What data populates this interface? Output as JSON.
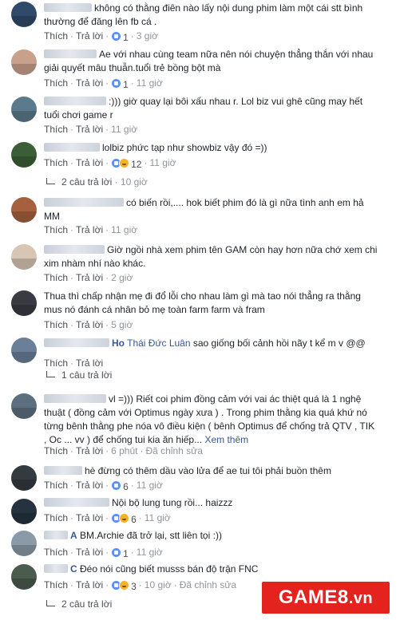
{
  "ui": {
    "like": "Thích",
    "reply": "Trả lời",
    "edited": "Đã chỉnh sửa",
    "see_more": "Xem thêm"
  },
  "comments": [
    {
      "name": "",
      "name_visible": "",
      "text": "không có thằng điên nào lấy nội dung phim làm một cái stt bình thường để đăng lên fb cá .",
      "reactions": [
        "like"
      ],
      "count": "1",
      "time": "3 giờ",
      "edited": false
    },
    {
      "name": "",
      "name_visible": "",
      "text": "Ae với nhau cùng team nữa nên nói chuyện thẳng thắn với nhau giải quyết mâu thuẫn.tuổi trẻ bồng bột mà",
      "reactions": [
        "like"
      ],
      "count": "1",
      "time": "11 giờ",
      "edited": false
    },
    {
      "name": "",
      "name_visible": "",
      "text": ":))) giờ quay lại bôi xấu nhau r. Lol biz vui ghê cũng may hết tuổi chơi game r",
      "reactions": [],
      "count": "",
      "time": "11 giờ",
      "edited": false
    },
    {
      "name": "",
      "name_visible": "",
      "text": "lolbiz phức tạp như showbiz vậy đó =))",
      "reactions": [
        "like",
        "haha"
      ],
      "count": "12",
      "time": "11 giờ",
      "edited": false,
      "replies": "2 câu trả lời",
      "replies_time": "10 giờ"
    },
    {
      "name": "",
      "name_visible": "",
      "text": "có biến rồi,.... hok biết phim đó là gì nữa tình anh em hả MM",
      "reactions": [],
      "count": "",
      "time": "11 giờ",
      "edited": false
    },
    {
      "name": "",
      "name_visible": "",
      "text": "Giờ ngồi nhà xem phim tên GAM còn hay hơn nữa chớ xem chi xim nhàm nhí nào khác.",
      "reactions": [],
      "count": "",
      "time": "2 giờ",
      "edited": false
    },
    {
      "name": "",
      "name_visible": "",
      "text": "Thua thì chấp nhận mẹ đi đổ lỗi cho nhau làm gì mà tao nói thẳng ra thằng mus nó đánh cá nhân bỏ mẹ toàn farm farm và fram",
      "reactions": [],
      "count": "",
      "time": "5 giờ",
      "edited": false
    },
    {
      "name": "",
      "name_visible": "Ho",
      "tag": "Thái Đức Luân",
      "text": "sao giống bối cảnh hồi nãy t kể m v @@",
      "reactions": [],
      "count": "",
      "time": "",
      "edited": false,
      "replies": "1 câu trả lời",
      "replies_time": ""
    },
    {
      "name": "",
      "name_visible": "",
      "text": "vl =)))  Riết coi phim đồng cảm với vai ác thiệt quá là 1 nghệ thuật ( đồng cảm với Optimus ngày xưa ) . Trong phim thằng kia quá khứ nó từng bênh thằng phe nóa vô điều kiện ( bênh Optimus để chống trả QTV , TIK , Oc ... vv ) để chống tui kia ăn hiếp...",
      "reactions": [],
      "count": "",
      "time": "6 phút",
      "edited": true
    },
    {
      "name": "",
      "name_visible": "",
      "text": "hè đừng có thêm dầu vào lửa để ae tui tôi phải buồn thêm",
      "reactions": [
        "like"
      ],
      "count": "6",
      "time": "11 giờ",
      "edited": false
    },
    {
      "name": "",
      "name_visible": "",
      "text": "Nội bộ lung tung rồi... haizzz",
      "reactions": [
        "like",
        "haha"
      ],
      "count": "6",
      "time": "11 giờ",
      "edited": false
    },
    {
      "name": "",
      "name_visible": "A",
      "text": "BM.Archie đã trở lại, stt liên tọi :))",
      "reactions": [
        "like"
      ],
      "count": "1",
      "time": "11 giờ",
      "edited": false
    },
    {
      "name": "",
      "name_visible": "C",
      "text": "Đéo nói cũng biết musss bán độ trận FNC",
      "reactions": [
        "like",
        "haha"
      ],
      "count": "3",
      "time": "10 giờ",
      "edited": true,
      "replies": "2 câu trả lời",
      "replies_time": ""
    }
  ],
  "watermark": {
    "text": "GAME8",
    "suffix": ".vn",
    "color": "#e4231f"
  },
  "colors": {
    "link": "#365899",
    "meta": "#90949c",
    "like": "#5890ff",
    "haha": "#f7b125"
  }
}
